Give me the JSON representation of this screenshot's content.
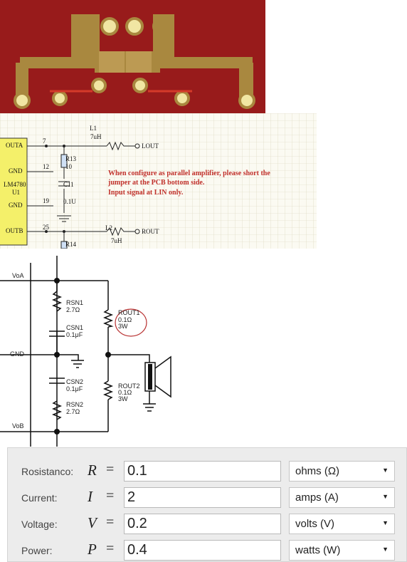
{
  "pcb_photo": {
    "colors": {
      "board": "#9a1c1c",
      "trace": "#a9883f",
      "pad": "#f1e6a3"
    }
  },
  "schematic_top": {
    "ic": {
      "name": "LM4780",
      "ref": "U1",
      "pins": [
        "OUTA",
        "GND",
        "GND",
        "OUTB"
      ]
    },
    "pin_numbers": [
      "7",
      "12",
      "19",
      "25"
    ],
    "components": {
      "l1_ref": "L1",
      "l1_value": "7uH",
      "l2_ref": "L2",
      "l2_value": "7uH",
      "r13": "R13",
      "r13_value": "10",
      "c11": "C11",
      "c11_value": "0.1U",
      "r14": "R14"
    },
    "outputs": {
      "lout": "LOUT",
      "rout": "ROUT"
    },
    "note": {
      "line1": "When configure as parallel amplifier, please short the",
      "line2": "jumper at the PCB bottom side.",
      "line3": "Input signal at LIN only."
    },
    "note_color": "#c0302a"
  },
  "schematic_bottom": {
    "nodes": {
      "voa": "VoA",
      "gnd": "GND",
      "vob": "VoB"
    },
    "rsn1": {
      "name": "RSN1",
      "value": "2.7Ω"
    },
    "csn1": {
      "name": "CSN1",
      "value": "0.1μF"
    },
    "csn2": {
      "name": "CSN2",
      "value": "0.1μF"
    },
    "rsn2": {
      "name": "RSN2",
      "value": "2.7Ω"
    },
    "rout1": {
      "name": "ROUT1",
      "value": "0.1Ω",
      "power": "3W"
    },
    "rout2": {
      "name": "ROUT2",
      "value": "0.1Ω",
      "power": "3W"
    },
    "highlight_color": "#b83030"
  },
  "calculator": {
    "rows": [
      {
        "label": "Rosistanco:",
        "symbol": "R",
        "value": "0.1",
        "unit": "ohms (Ω)"
      },
      {
        "label": "Current:",
        "symbol": "I",
        "value": "2",
        "unit": "amps (A)"
      },
      {
        "label": "Voltage:",
        "symbol": "V",
        "value": "0.2",
        "unit": "volts (V)"
      },
      {
        "label": "Power:",
        "symbol": "P",
        "value": "0.4",
        "unit": "watts (W)"
      }
    ],
    "equals": "=",
    "dropdown_icon": "triangle-down"
  }
}
